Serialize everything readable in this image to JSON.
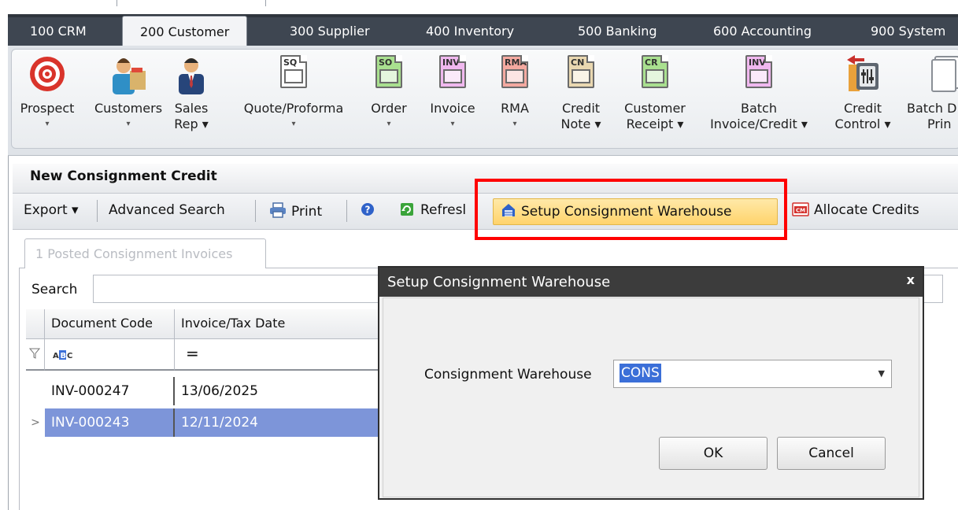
{
  "main_tabs": [
    {
      "label": "100 CRM"
    },
    {
      "label": "200 Customer"
    },
    {
      "label": "300 Supplier"
    },
    {
      "label": "400 Inventory"
    },
    {
      "label": "500 Banking"
    },
    {
      "label": "600 Accounting"
    },
    {
      "label": "900 System"
    }
  ],
  "ribbon": {
    "buttons": [
      {
        "line1": "Prospect",
        "line2": "▾",
        "icon": "target-icon"
      },
      {
        "line1": "Customers",
        "line2": "▾",
        "icon": "customers-icon"
      },
      {
        "line1": "Sales",
        "line2": "Rep ▾",
        "icon": "sales-rep-icon"
      },
      {
        "line1": "Quote/Proforma",
        "line2": "▾",
        "icon": "quote-doc-icon",
        "doc": "SQ",
        "color": "#ffffff"
      },
      {
        "line1": "Order",
        "line2": "▾",
        "icon": "order-doc-icon",
        "doc": "SO",
        "color": "#a9e08f"
      },
      {
        "line1": "Invoice",
        "line2": "▾",
        "icon": "invoice-doc-icon",
        "doc": "INV",
        "color": "#f0b8ef"
      },
      {
        "line1": "RMA",
        "line2": "▾",
        "icon": "rma-doc-icon",
        "doc": "RMA",
        "color": "#f4a9a0"
      },
      {
        "line1": "Credit",
        "line2": "Note ▾",
        "icon": "credit-note-doc-icon",
        "doc": "CN",
        "color": "#e9d7b0"
      },
      {
        "line1": "Customer",
        "line2": "Receipt ▾",
        "icon": "customer-receipt-doc-icon",
        "doc": "CR",
        "color": "#a9e08f"
      },
      {
        "line1": "Batch",
        "line2": "Invoice/Credit ▾",
        "icon": "batch-invoice-doc-icon",
        "doc": "INV",
        "color": "#f0b8ef"
      },
      {
        "line1": "Credit",
        "line2": "Control ▾",
        "icon": "credit-control-icon"
      },
      {
        "line1": "Batch D",
        "line2": "Prin",
        "icon": "batch-print-icon"
      }
    ]
  },
  "subwindow": {
    "title": "New Consignment Credit"
  },
  "toolbar": {
    "export": "Export ▾",
    "advanced_search": "Advanced Search",
    "print": "Print",
    "refresh": "Refresl",
    "setup_warehouse": "Setup Consignment Warehouse",
    "allocate_credits": "Allocate Credits"
  },
  "inner_tab": {
    "label": "1 Posted Consignment Invoices"
  },
  "search": {
    "label": "Search",
    "value": ""
  },
  "grid": {
    "columns": [
      "Document Code",
      "Invoice/Tax Date"
    ],
    "filter_symbol": "=",
    "rows": [
      {
        "code": "INV-000247",
        "date": "13/06/2025",
        "selected": false
      },
      {
        "code": "INV-000243",
        "date": "12/11/2024",
        "selected": true
      }
    ]
  },
  "dialog": {
    "title": "Setup Consignment Warehouse",
    "close": "x",
    "field_label": "Consignment Warehouse",
    "field_value": "CONS",
    "ok": "OK",
    "cancel": "Cancel"
  }
}
